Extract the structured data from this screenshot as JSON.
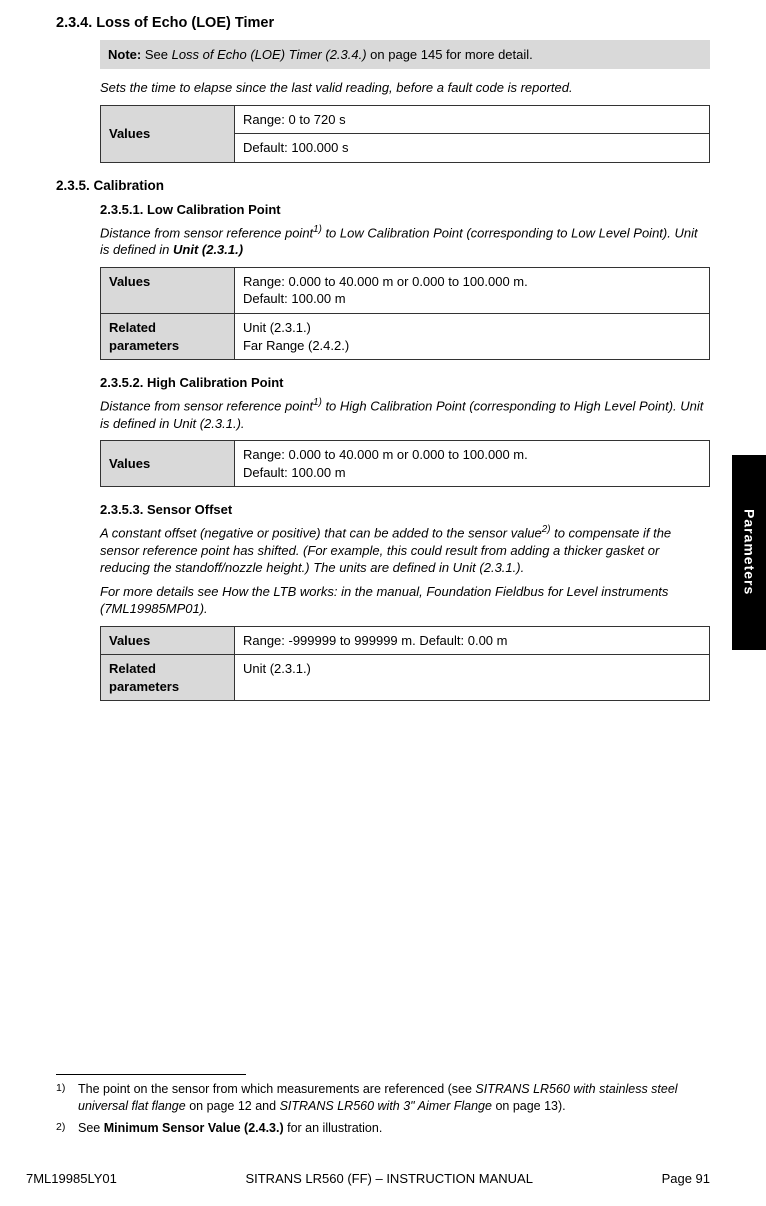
{
  "sideTab": "Parameters",
  "s234": {
    "heading": "2.3.4.  Loss of Echo (LOE) Timer",
    "note_prefix": "Note: ",
    "note_see": "See ",
    "note_link": "Loss of Echo (LOE) Timer (2.3.4.) ",
    "note_rest": " on page 145 for more detail.",
    "desc": "Sets the time to elapse since the last valid reading, before a fault code is reported.",
    "values_label": "Values",
    "range": "Range: 0 to 720 s",
    "default": "Default: 100.000 s"
  },
  "s235": {
    "heading": "2.3.5.  Calibration"
  },
  "s2351": {
    "heading": "2.3.5.1.    Low Calibration Point",
    "desc_a": "Distance from sensor reference point",
    "desc_b": " to Low Calibration Point (corresponding to Low Level Point). Unit is defined in ",
    "desc_c": "Unit (2.3.1.)",
    "values_label": "Values",
    "values_text": "Range: 0.000 to 40.000 m or 0.000 to 100.000 m.\nDefault: 100.00 m",
    "rel_label": "Related parameters",
    "rel_text": "Unit (2.3.1.)\nFar Range (2.4.2.)"
  },
  "s2352": {
    "heading": "2.3.5.2.    High Calibration Point",
    "desc_a": "Distance from sensor reference point",
    "desc_b": " to High Calibration Point (corresponding to High Level Point). Unit is defined in Unit (2.3.1.).",
    "values_label": "Values",
    "values_text": "Range: 0.000 to 40.000 m or 0.000 to 100.000 m.\nDefault: 100.00 m"
  },
  "s2353": {
    "heading": "2.3.5.3.    Sensor Offset",
    "desc_a": "A constant offset (negative or positive) that can be added to the sensor value",
    "desc_b": " to compensate if the sensor reference point has shifted. (For example, this could result from adding a thicker gasket or reducing the standoff/nozzle height.) The units are defined in Unit (2.3.1.).",
    "desc2": "For more details see How the LTB works: in the manual, Foundation Fieldbus for Level instruments (7ML19985MP01).",
    "values_label": "Values",
    "values_text": "Range: -999999 to 999999 m. Default: 0.00 m",
    "rel_label": "Related parameters",
    "rel_text": "Unit (2.3.1.)"
  },
  "fn1": {
    "mark": "1)",
    "a": "The point on the sensor from which measurements are referenced (see ",
    "b": "SITRANS LR560 with stainless steel universal flat flange ",
    "c": " on page 12 and ",
    "d": "SITRANS LR560 with 3\" Aimer Flange ",
    "e": " on page 13)."
  },
  "fn2": {
    "mark": "2)",
    "a": "See ",
    "b": "Minimum Sensor Value (2.4.3.)",
    "c": " for an illustration."
  },
  "footer": {
    "left": "7ML19985LY01",
    "center": "SITRANS LR560 (FF) – INSTRUCTION MANUAL",
    "right": "Page 91"
  }
}
